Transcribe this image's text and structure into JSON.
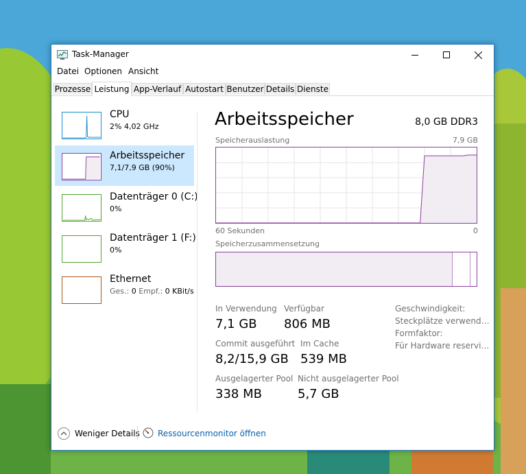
{
  "window": {
    "title": "Task-Manager",
    "colors": {
      "accent": "#1f75c4",
      "memory": "#8b3e9e",
      "cpu": "#1a8ed0",
      "disk": "#4ea52f",
      "ethernet": "#a7561a",
      "selected": "#cce8ff"
    }
  },
  "menu": [
    "Datei",
    "Optionen",
    "Ansicht"
  ],
  "tabs": [
    "Prozesse",
    "Leistung",
    "App-Verlauf",
    "Autostart",
    "Benutzer",
    "Details",
    "Dienste"
  ],
  "active_tab": "Leistung",
  "sidebar": {
    "items": [
      {
        "name": "CPU",
        "sub": "2% 4,02 GHz",
        "icon": "cpu-graph"
      },
      {
        "name": "Arbeitsspeicher",
        "sub": "7,1/7,9 GB (90%)",
        "icon": "memory-graph",
        "selected": true
      },
      {
        "name": "Datenträger 0 (C:)",
        "sub": "0%",
        "icon": "disk-graph"
      },
      {
        "name": "Datenträger 1 (F:)",
        "sub": "0%",
        "icon": "disk-graph"
      },
      {
        "name": "Ethernet",
        "sub_gray1": "Ges.: ",
        "sub_v1": "0",
        "sub_gray2": " Empf.: ",
        "sub_v2": "0 KBit/s",
        "icon": "ethernet-graph"
      }
    ]
  },
  "memory": {
    "title": "Arbeitsspeicher",
    "spec": "8,0 GB DDR3",
    "usage_label": "Speicherauslastung",
    "usage_max": "7,9 GB",
    "time_left": "60 Sekunden",
    "time_right": "0",
    "usage_history_percent": [
      0,
      0,
      0,
      0,
      0,
      0,
      0,
      0,
      0,
      0,
      0,
      0,
      0,
      0,
      0,
      0,
      0,
      0,
      0,
      0,
      0,
      0,
      0,
      0,
      0,
      0,
      0,
      0,
      0,
      0,
      0,
      0,
      0,
      0,
      0,
      0,
      0,
      0,
      0,
      0,
      0,
      0,
      0,
      0,
      0,
      0,
      0,
      0,
      89,
      89,
      89,
      89,
      89,
      89,
      89,
      89,
      89,
      89,
      90,
      90,
      90
    ],
    "composition_label": "Speicherzusammensetzung",
    "stats": {
      "in_use_label": "In Verwendung",
      "in_use": "7,1 GB",
      "available_label": "Verfügbar",
      "available": "806 MB",
      "commit_label": "Commit ausgeführt",
      "commit": "8,2/15,9 GB",
      "cached_label": "Im Cache",
      "cached": "539 MB",
      "paged_label": "Ausgelagerter Pool",
      "paged": "338 MB",
      "nonpaged_label": "Nicht ausgelagerter Pool",
      "nonpaged": "5,7 GB"
    },
    "details": [
      "Geschwindigkeit:",
      "Steckplätze verwend…",
      "Formfaktor:",
      "Für Hardware reservi…"
    ]
  },
  "footer": {
    "less_details": "Weniger Details",
    "resource_monitor": "Ressourcenmonitor öffnen"
  }
}
